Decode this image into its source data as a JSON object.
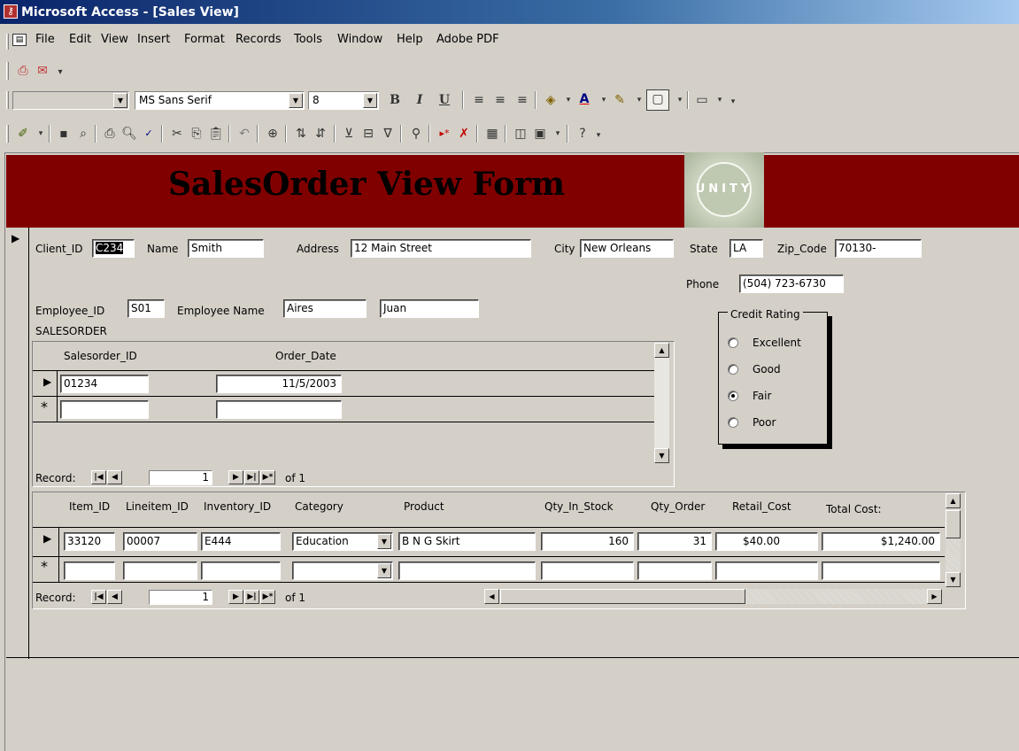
{
  "window": {
    "title": "Microsoft Access - [Sales View]",
    "app_icon": "access-key-icon"
  },
  "menu": {
    "items": [
      "File",
      "Edit",
      "View",
      "Insert",
      "Format",
      "Records",
      "Tools",
      "Window",
      "Help",
      "Adobe PDF"
    ]
  },
  "toolbar_format": {
    "object_combo": "",
    "font_name": "MS Sans Serif",
    "font_size": "8",
    "bold": "B",
    "italic": "I",
    "underline": "U"
  },
  "form": {
    "title": "SalesOrder View Form",
    "logo_text": "UNITY",
    "labels": {
      "client_id": "Client_ID",
      "name": "Name",
      "address": "Address",
      "city": "City",
      "state": "State",
      "zip": "Zip_Code",
      "phone": "Phone",
      "employee_id": "Employee_ID",
      "employee_name": "Employee Name",
      "salesorder": "SALESORDER"
    },
    "values": {
      "client_id": "C234",
      "name": "Smith",
      "address": "12 Main Street",
      "city": "New Orleans",
      "state": "LA",
      "zip": "70130-",
      "phone": "(504) 723-6730",
      "employee_id": "S01",
      "employee_last": "Aires",
      "employee_first": "Juan"
    },
    "credit_rating": {
      "title": "Credit Rating",
      "options": [
        "Excellent",
        "Good",
        "Fair",
        "Poor"
      ],
      "selected": "Fair"
    }
  },
  "salesorder_subform": {
    "headers": [
      "Salesorder_ID",
      "Order_Date"
    ],
    "rows": [
      [
        "01234",
        "11/5/2003"
      ]
    ],
    "nav": {
      "label": "Record:",
      "current": "1",
      "of": "of 1"
    }
  },
  "lineitem_subform": {
    "headers": [
      "Item_ID",
      "Lineitem_ID",
      "Inventory_ID",
      "Category",
      "Product",
      "Qty_In_Stock",
      "Qty_Order",
      "Retail_Cost",
      "Total Cost:"
    ],
    "rows": [
      [
        "33120",
        "00007",
        "E444",
        "Education",
        "B N G Skirt",
        "160",
        "31",
        "$40.00",
        "$1,240.00"
      ]
    ],
    "nav": {
      "label": "Record:",
      "current": "1",
      "of": "of 1"
    }
  }
}
